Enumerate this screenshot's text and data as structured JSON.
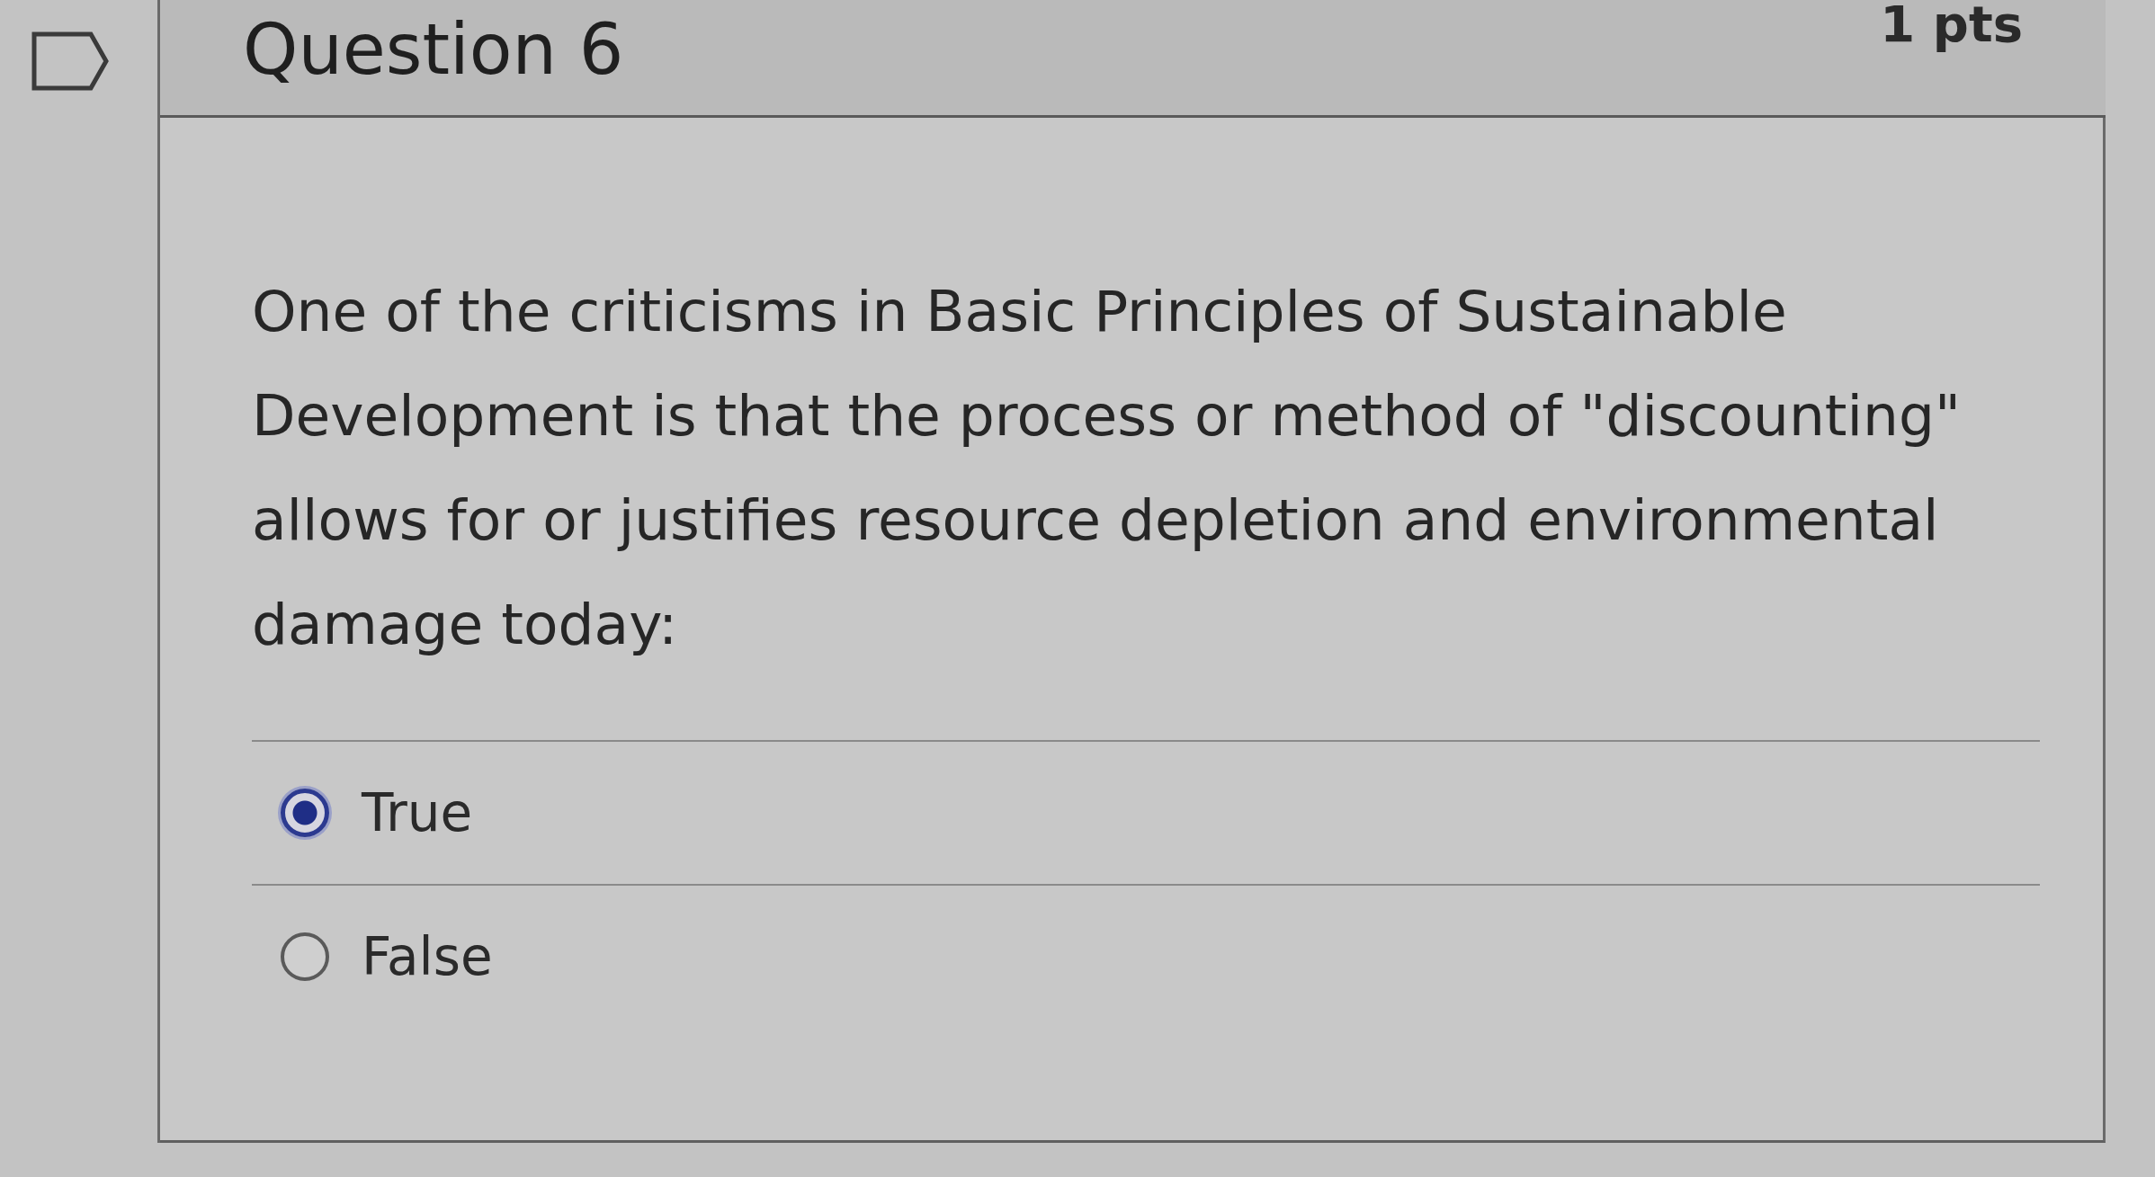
{
  "question": {
    "flagged": false,
    "title": "Question 6",
    "points": "1 pts",
    "text": "One of the criticisms in Basic Principles of Sustainable Development is that the process or method of \"discounting\" allows for or justifies resource depletion and environmental damage today:"
  },
  "answers": [
    {
      "label": "True",
      "selected": true
    },
    {
      "label": "False",
      "selected": false
    }
  ]
}
